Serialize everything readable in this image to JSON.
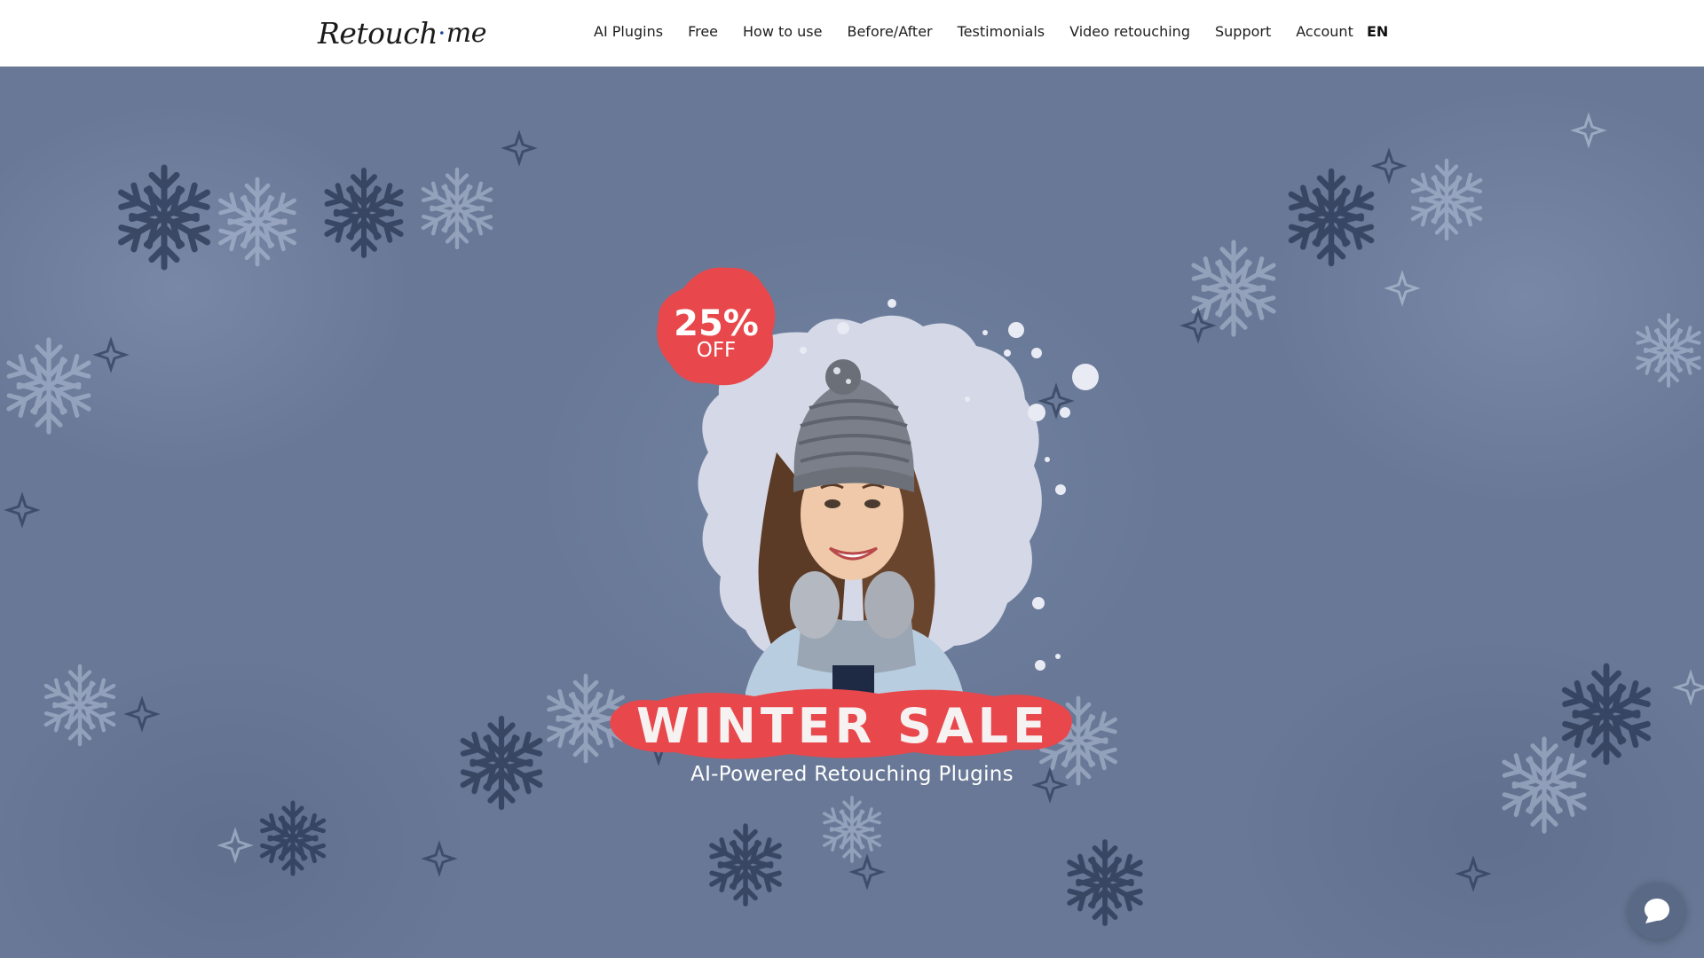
{
  "header": {
    "logo": {
      "left": "Retouch",
      "right": "me"
    },
    "nav": [
      "AI Plugins",
      "Free",
      "How to use",
      "Before/After",
      "Testimonials",
      "Video retouching",
      "Support",
      "Account"
    ],
    "language": "EN"
  },
  "hero": {
    "badge": {
      "percent": "25%",
      "off": "OFF"
    },
    "banner": "WINTER SALE",
    "tagline": "AI-Powered Retouching Plugins"
  },
  "colors": {
    "header_bg": "#ffffff",
    "hero_bg": "#687896",
    "sale_red": "#e8484c"
  },
  "icons": {
    "chat": "chat-bubble-icon",
    "background": "snowflake-icon"
  }
}
